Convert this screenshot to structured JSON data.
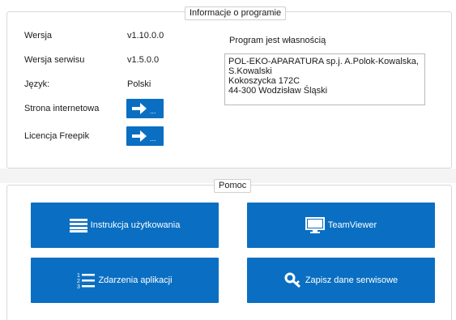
{
  "info": {
    "legend": "Informacje o programie",
    "version_label": "Wersja",
    "version_value": "v1.10.0.0",
    "service_version_label": "Wersja serwisu",
    "service_version_value": "v1.5.0.0",
    "language_label": "Język:",
    "language_value": "Polski",
    "website_label": "Strona internetowa",
    "license_label": "Licencja Freepik",
    "arrow_button_dots": "...",
    "owner_label": "Program jest własnością",
    "owner_lines": [
      "POL-EKO-APARATURA sp.j. A.Polok-Kowalska,",
      "S.Kowalski",
      "Kokoszycka 172C",
      "44-300 Wodzisław Śląski"
    ]
  },
  "help": {
    "legend": "Pomoc",
    "manual_label": "Instrukcja użytkowania",
    "teamviewer_label": "TeamViewer",
    "events_label": "Zdarzenia aplikacji",
    "service_data_label": "Zapisz dane serwisowe"
  },
  "colors": {
    "button_blue": "#0a6fc2"
  },
  "icons": {
    "arrow": "arrow-right-icon",
    "manual": "list-icon",
    "teamviewer": "monitor-icon",
    "events": "numbered-list-icon",
    "service": "key-icon"
  }
}
